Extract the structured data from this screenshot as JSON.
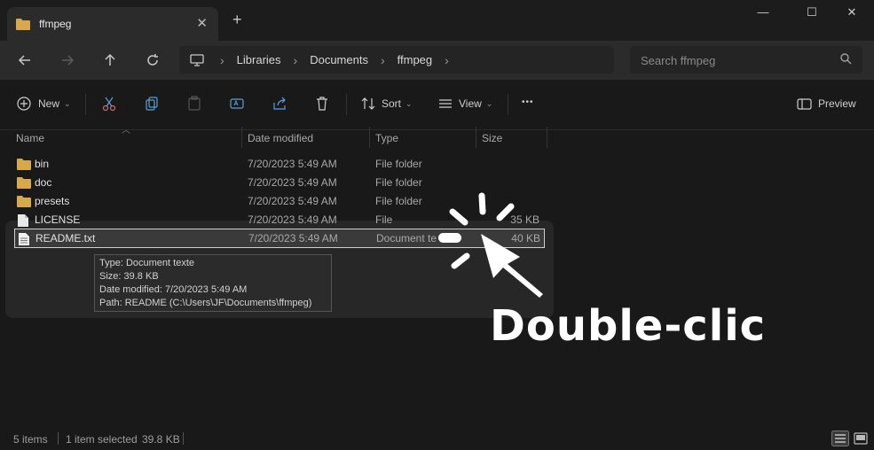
{
  "window": {
    "tab_title": "ffmpeg",
    "close_label": "✕",
    "new_tab_label": "+"
  },
  "window_controls": {
    "minimize": "—",
    "maximize": "☐",
    "close": "✕"
  },
  "address": {
    "crumbs": [
      "Libraries",
      "Documents",
      "ffmpeg"
    ],
    "search_placeholder": "Search ffmpeg"
  },
  "toolbar": {
    "new_label": "New",
    "sort_label": "Sort",
    "view_label": "View",
    "more_label": "•••",
    "preview_label": "Preview"
  },
  "columns": {
    "name": "Name",
    "date": "Date modified",
    "type": "Type",
    "size": "Size"
  },
  "files": [
    {
      "name": "bin",
      "date": "7/20/2023 5:49 AM",
      "type": "File folder",
      "size": "",
      "kind": "folder"
    },
    {
      "name": "doc",
      "date": "7/20/2023 5:49 AM",
      "type": "File folder",
      "size": "",
      "kind": "folder"
    },
    {
      "name": "presets",
      "date": "7/20/2023 5:49 AM",
      "type": "File folder",
      "size": "",
      "kind": "folder"
    },
    {
      "name": "LICENSE",
      "date": "7/20/2023 5:49 AM",
      "type": "File",
      "size": "35 KB",
      "kind": "file"
    },
    {
      "name": "README.txt",
      "date": "7/20/2023 5:49 AM",
      "type": "Document te",
      "size": "40 KB",
      "kind": "file"
    }
  ],
  "tooltip": {
    "type": "Type: Document texte",
    "size": "Size: 39.8 KB",
    "date": "Date modified: 7/20/2023 5:49 AM",
    "path": "Path: README (C:\\Users\\JF\\Documents\\ffmpeg)"
  },
  "annotation": {
    "label": "Double-clic"
  },
  "status": {
    "items": "5 items",
    "selected": "1 item selected",
    "size": "39.8 KB"
  },
  "colors": {
    "accent": "#ffffff",
    "folder": "#d8a94a",
    "background": "#191919"
  }
}
